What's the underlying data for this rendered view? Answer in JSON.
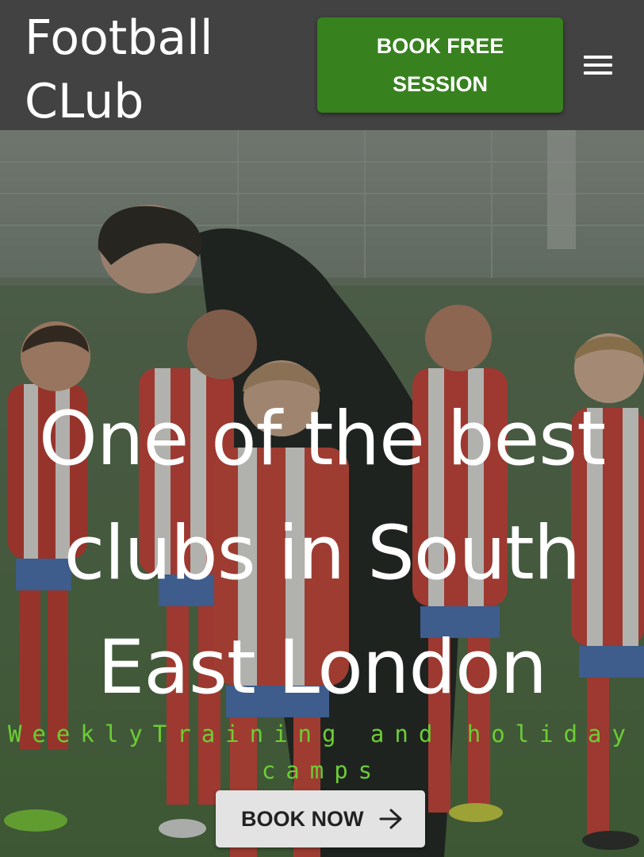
{
  "header": {
    "logo_line1": "Football",
    "logo_line2": "CLub",
    "book_free_line1": "BOOK FREE",
    "book_free_line2": "SESSION",
    "menu_icon": "hamburger-menu-icon"
  },
  "hero": {
    "background": "photo of a football coach crouching among a group of young players in red and white striped kits on a pitch",
    "headline_line1": "One of the best",
    "headline_line2": "clubs in South",
    "headline_line3": "East London",
    "tagline_line1": "WeeklyTraining and holiday",
    "tagline_line2": "camps",
    "cta_label": "BOOK NOW",
    "cta_icon": "arrow-right-icon"
  },
  "colors": {
    "header_bg": "#424242",
    "book_free_bg": "#37811f",
    "tagline": "#6ccd35",
    "cta_bg": "#e3e3e3",
    "headline": "#ffffff"
  }
}
